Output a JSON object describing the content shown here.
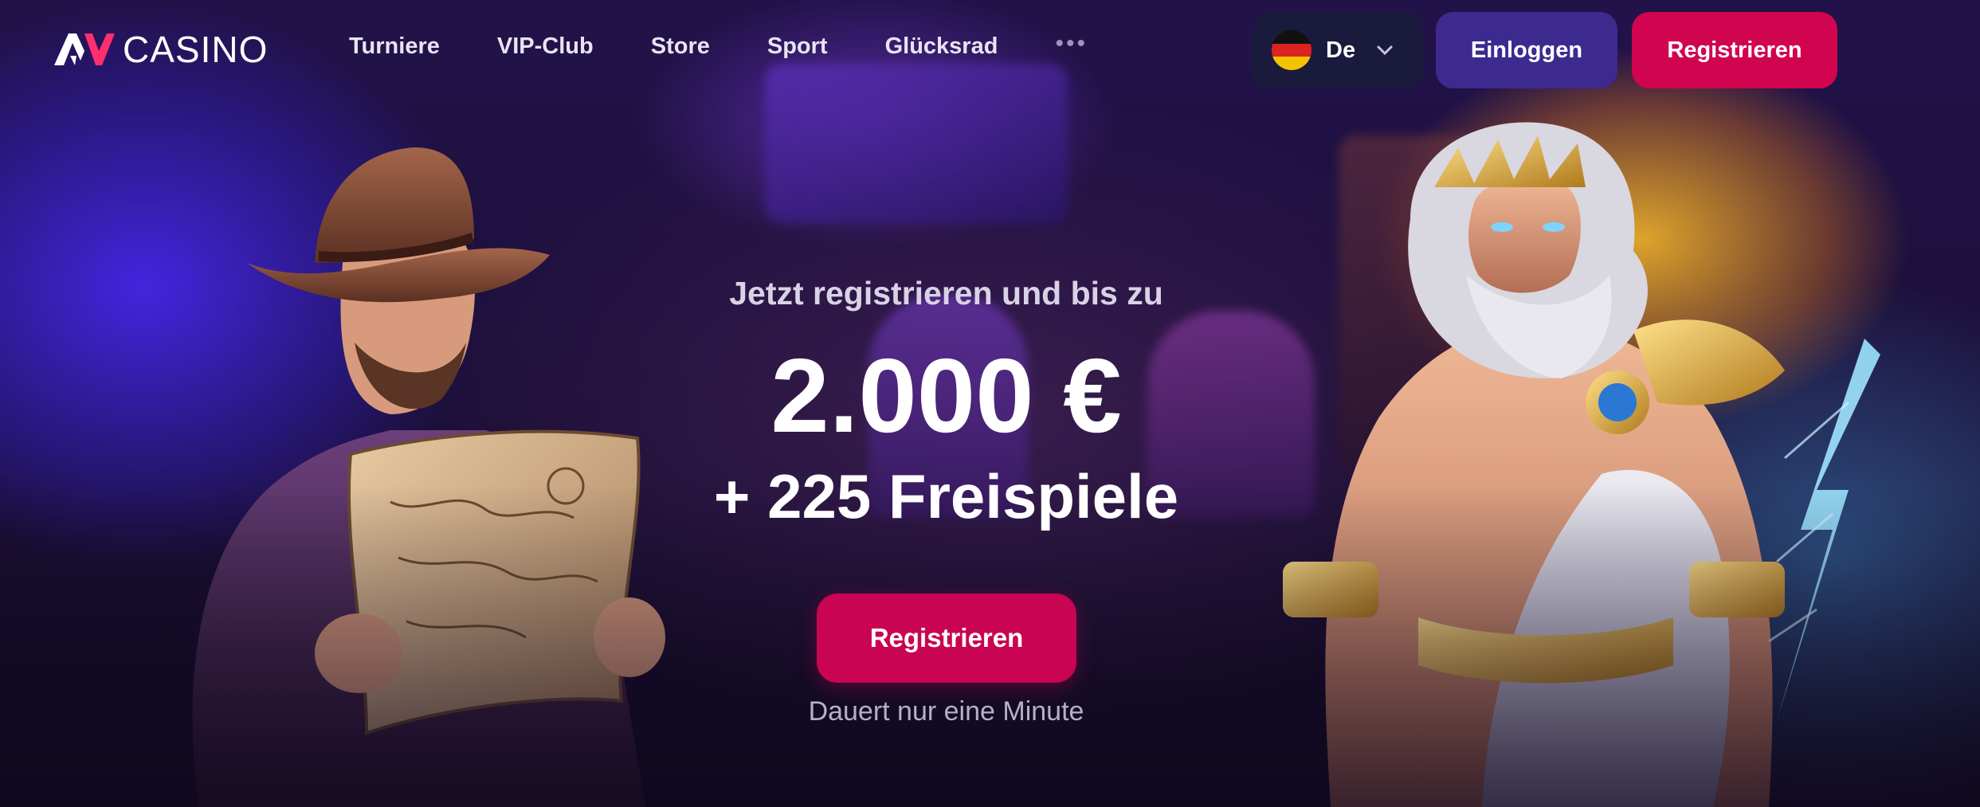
{
  "brand": {
    "logo_mark": "AV",
    "logo_text": "CASINO"
  },
  "nav": {
    "items": [
      "Turniere",
      "VIP-Club",
      "Store",
      "Sport",
      "Glücksrad"
    ],
    "more_label": "•••"
  },
  "language": {
    "label": "De",
    "flag": "germany-flag-icon"
  },
  "header_buttons": {
    "login": "Einloggen",
    "register": "Registrieren"
  },
  "hero": {
    "subtitle": "Jetzt registrieren und bis zu",
    "amount": "2.000 €",
    "free_spins": "+ 225 Freispiele",
    "cta": "Registrieren",
    "note": "Dauert nur eine Minute"
  },
  "colors": {
    "primary_pink": "#d0044f",
    "login_purple": "#3d2a8f",
    "lang_bg": "#1a1a3c"
  }
}
